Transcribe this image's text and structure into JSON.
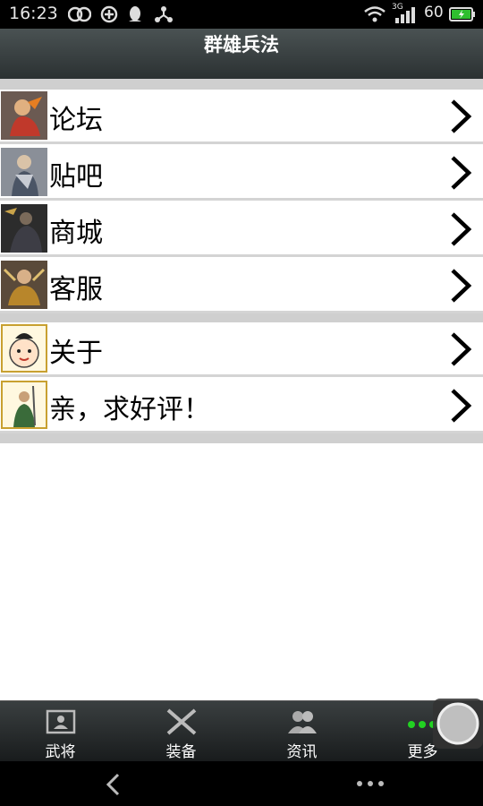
{
  "status_bar": {
    "time": "16:23",
    "battery": "60",
    "network_label": "3G",
    "icons": [
      "sync-icon",
      "refresh-icon",
      "qq-icon",
      "share-icon",
      "wifi-icon",
      "signal-icon",
      "battery-icon"
    ]
  },
  "header": {
    "title": "群雄兵法"
  },
  "menu": {
    "group1": [
      {
        "label": "论坛",
        "icon": "forum-avatar-icon"
      },
      {
        "label": "贴吧",
        "icon": "tieba-avatar-icon"
      },
      {
        "label": "商城",
        "icon": "shop-avatar-icon"
      },
      {
        "label": "客服",
        "icon": "service-avatar-icon"
      }
    ],
    "group2": [
      {
        "label": "关于",
        "icon": "about-avatar-icon"
      },
      {
        "label": "亲，求好评！",
        "icon": "rate-avatar-icon"
      }
    ]
  },
  "tabbar": {
    "tabs": [
      {
        "label": "武将",
        "icon": "id-card-icon"
      },
      {
        "label": "装备",
        "icon": "crossed-swords-icon"
      },
      {
        "label": "资讯",
        "icon": "people-icon"
      },
      {
        "label": "更多",
        "icon": "more-dots-icon"
      }
    ]
  },
  "colors": {
    "accent_green": "#22d222",
    "title_bar": "#3b4243",
    "separator": "#cfcfcf"
  }
}
